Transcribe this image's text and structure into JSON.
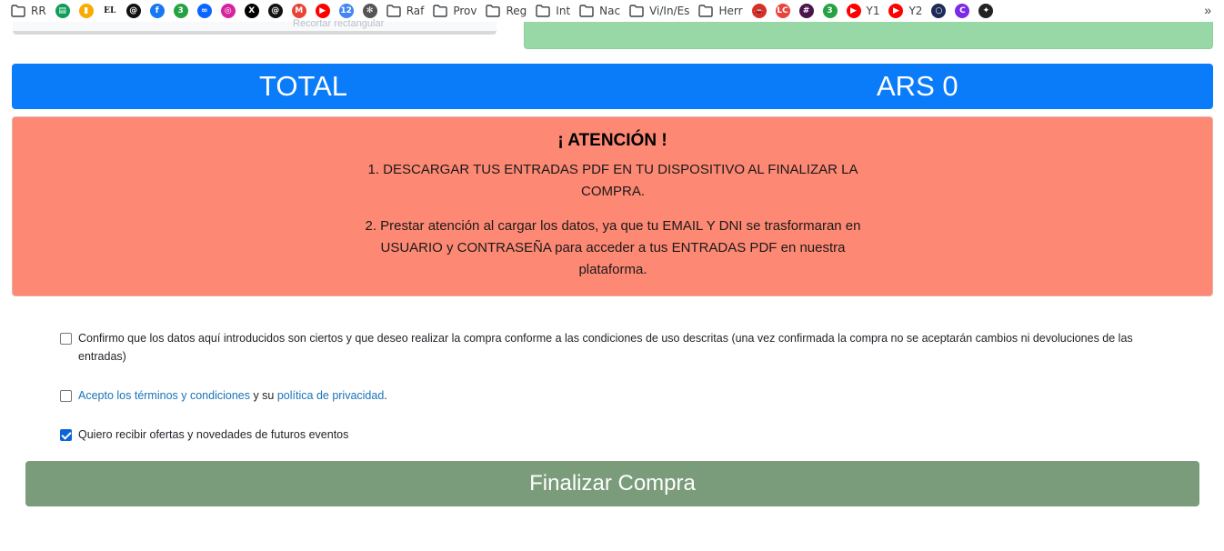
{
  "bookmarks": [
    {
      "type": "folder",
      "label": "RR"
    },
    {
      "type": "icon",
      "icon": "sheets-icon",
      "color": "#0f9d58",
      "glyph": "▤",
      "label": ""
    },
    {
      "type": "icon",
      "icon": "analytics-icon",
      "color": "#f9ab00",
      "glyph": "▮",
      "label": ""
    },
    {
      "type": "icon",
      "icon": "el-pais-icon",
      "color": "#ffffff",
      "glyph": "EL",
      "label": ""
    },
    {
      "type": "icon",
      "icon": "threads-icon",
      "color": "#111111",
      "glyph": "@",
      "label": ""
    },
    {
      "type": "icon",
      "icon": "facebook-icon",
      "color": "#1877f2",
      "glyph": "f",
      "label": ""
    },
    {
      "type": "icon",
      "icon": "whatsapp-3-icon",
      "color": "#25a244",
      "glyph": "3",
      "label": ""
    },
    {
      "type": "icon",
      "icon": "meta-icon",
      "color": "#0866ff",
      "glyph": "∞",
      "label": ""
    },
    {
      "type": "icon",
      "icon": "instagram-icon",
      "color": "#d6249f",
      "glyph": "◎",
      "label": ""
    },
    {
      "type": "icon",
      "icon": "x-icon",
      "color": "#000000",
      "glyph": "X",
      "label": ""
    },
    {
      "type": "icon",
      "icon": "threads-icon",
      "color": "#111111",
      "glyph": "@",
      "label": ""
    },
    {
      "type": "icon",
      "icon": "gmail-icon",
      "color": "#ea4335",
      "glyph": "M",
      "label": ""
    },
    {
      "type": "icon",
      "icon": "youtube-icon",
      "color": "#ff0000",
      "glyph": "▶",
      "label": ""
    },
    {
      "type": "icon",
      "icon": "calendar-icon",
      "color": "#4285f4",
      "glyph": "12",
      "label": ""
    },
    {
      "type": "icon",
      "icon": "chatgpt-icon",
      "color": "#555555",
      "glyph": "✻",
      "label": ""
    },
    {
      "type": "folder",
      "label": "Raf"
    },
    {
      "type": "folder",
      "label": "Prov"
    },
    {
      "type": "folder",
      "label": "Reg"
    },
    {
      "type": "folder",
      "label": "Int"
    },
    {
      "type": "folder",
      "label": "Nac"
    },
    {
      "type": "folder",
      "label": "Vi/In/Es"
    },
    {
      "type": "folder",
      "label": "Herr"
    },
    {
      "type": "icon",
      "icon": "car-icon",
      "color": "#d93025",
      "glyph": "🚗",
      "label": ""
    },
    {
      "type": "icon",
      "icon": "lc-icon",
      "color": "#e8453c",
      "glyph": "LC",
      "label": ""
    },
    {
      "type": "icon",
      "icon": "slack-icon",
      "color": "#4a154b",
      "glyph": "#",
      "label": ""
    },
    {
      "type": "icon",
      "icon": "whatsapp-3-icon",
      "color": "#25a244",
      "glyph": "3",
      "label": ""
    },
    {
      "type": "icon",
      "icon": "youtube-icon",
      "color": "#ff0000",
      "glyph": "▶",
      "label": "Y1"
    },
    {
      "type": "icon",
      "icon": "youtube-icon",
      "color": "#ff0000",
      "glyph": "▶",
      "label": "Y2"
    },
    {
      "type": "icon",
      "icon": "circle-app-icon",
      "color": "#1f2b57",
      "glyph": "○",
      "label": ""
    },
    {
      "type": "icon",
      "icon": "canva-icon",
      "color": "#7d2ae8",
      "glyph": "C",
      "label": ""
    },
    {
      "type": "icon",
      "icon": "compass-icon",
      "color": "#222222",
      "glyph": "✦",
      "label": ""
    }
  ],
  "bookmarks_more": "»",
  "ghost_text": "Recortar rectangular",
  "total": {
    "label": "TOTAL",
    "value": "ARS 0"
  },
  "attention": {
    "title": "¡ ATENCIÓN !",
    "item1": "1. DESCARGAR TUS ENTRADAS PDF EN TU DISPOSITIVO AL FINALIZAR LA COMPRA.",
    "item2": "2. Prestar atención al cargar los datos, ya que tu EMAIL Y DNI se trasformaran en USUARIO y CONTRASEÑA para acceder a tus ENTRADAS PDF en nuestra plataforma."
  },
  "checks": {
    "confirm": {
      "text": "Confirmo que los datos aquí introducidos son ciertos y que deseo realizar la compra conforme a las condiciones de uso descritas (una vez confirmada la compra no se aceptarán cambios ni devoluciones de las entradas)",
      "checked": false
    },
    "terms": {
      "link1": "Acepto los términos y condiciones",
      "middle": " y su ",
      "link2": "política de privacidad",
      "end": ".",
      "checked": false
    },
    "offers": {
      "text": "Quiero recibir ofertas y novedades de futuros eventos",
      "checked": true
    }
  },
  "finalize_label": "Finalizar Compra",
  "colors": {
    "total_bar": "#0b7cf9",
    "attention_bg": "#fd8873",
    "finalize_bg": "#7a9c7b",
    "link": "#1a73b8",
    "checkbox_checked": "#0b65d6"
  }
}
